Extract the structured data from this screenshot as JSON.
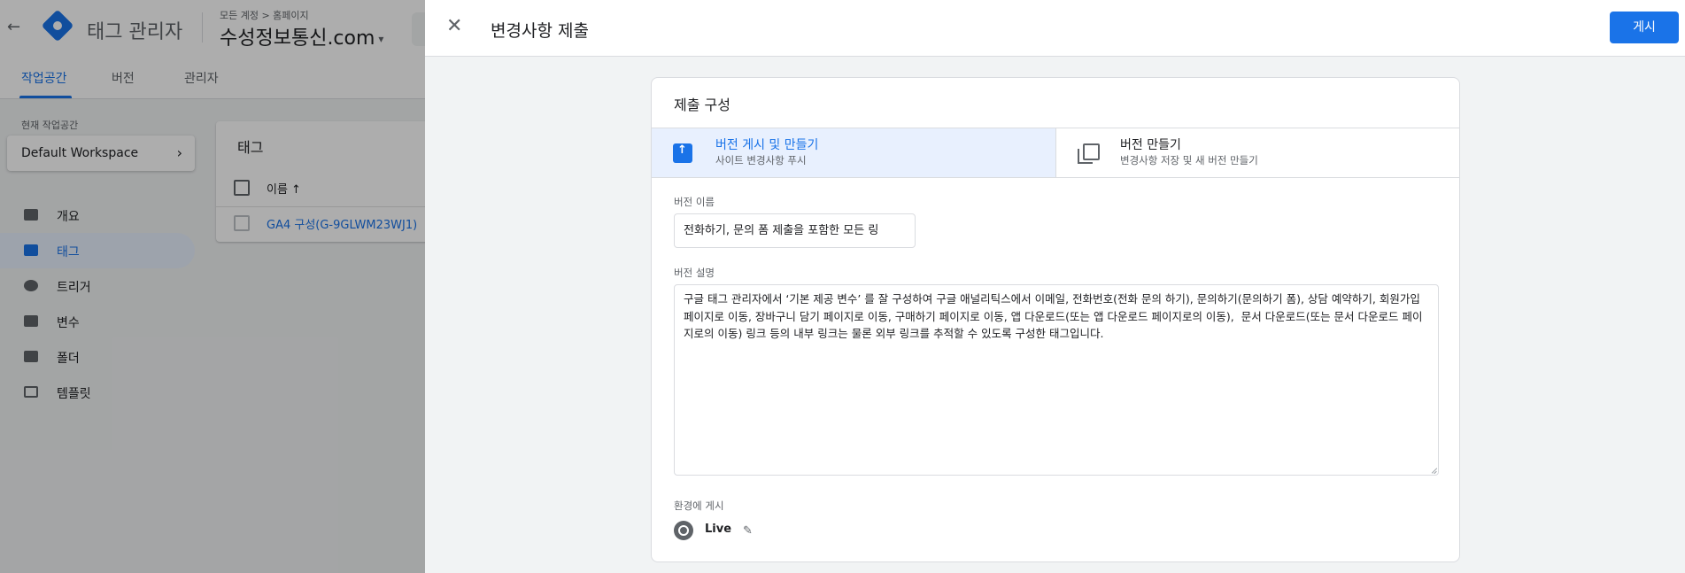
{
  "app": {
    "back_icon": "arrow-left-icon",
    "product_name": "태그 관리자",
    "breadcrumb": "모든 계정 > 홈페이지",
    "container_name": "수성정보통신.com",
    "container_caret": "▾"
  },
  "nav": {
    "tabs": [
      "작업공간",
      "버전",
      "관리자"
    ],
    "active_tab": "작업공간"
  },
  "workspace": {
    "label": "현재 작업공간",
    "name": "Default Workspace",
    "chevron": "›"
  },
  "sidebar": {
    "items": [
      {
        "label": "개요",
        "icon": "briefcase-icon"
      },
      {
        "label": "태그",
        "icon": "tag-icon",
        "active": true
      },
      {
        "label": "트리거",
        "icon": "trigger-icon"
      },
      {
        "label": "변수",
        "icon": "variables-icon"
      },
      {
        "label": "폴더",
        "icon": "folder-icon"
      },
      {
        "label": "템플릿",
        "icon": "template-icon"
      }
    ]
  },
  "tags_card": {
    "title": "태그",
    "column_name": "이름 ↑",
    "rows": [
      "GA4 구성(G-9GLWM23WJ1)"
    ]
  },
  "panel": {
    "close_glyph": "✕",
    "title": "변경사항 제출",
    "publish_label": "게시",
    "config_title": "제출 구성",
    "options": [
      {
        "title": "버전 게시 및 만들기",
        "subtitle": "사이트 변경사항 푸시",
        "icon": "publish-icon",
        "selected": true
      },
      {
        "title": "버전 만들기",
        "subtitle": "변경사항 저장 및 새 버전 만들기",
        "icon": "copy-icon",
        "selected": false
      }
    ],
    "version_name_label": "버전 이름",
    "version_name_value": "전화하기, 문의 폼 제출을 포함한 모든 링",
    "version_desc_label": "버전 설명",
    "version_desc_value": "구글 태그 관리자에서 ‘기본 제공 변수’ 를 잘 구성하여 구글 애널리틱스에서 이메일, 전화번호(전화 문의 하기), 문의하기(문의하기 폼), 상담 예약하기, 회원가입 페이지로 이동, 장바구니 담기 페이지로 이동, 구매하기 페이지로 이동, 앱 다운로드(또는 앱 다운로드 페이지로의 이동),  문서 다운로드(또는 문서 다운로드 페이지로의 이동) 링크 등의 내부 링크는 물론 외부 링크를 추적할 수 있도록 구성한 태그입니다.",
    "environment_label": "환경에 게시",
    "environment_name": "Live",
    "edit_glyph": "✎"
  },
  "colors": {
    "accent": "#1a73e8",
    "selected_bg": "#e8f0fe",
    "scrim": "rgba(0,0,0,0.32)"
  }
}
